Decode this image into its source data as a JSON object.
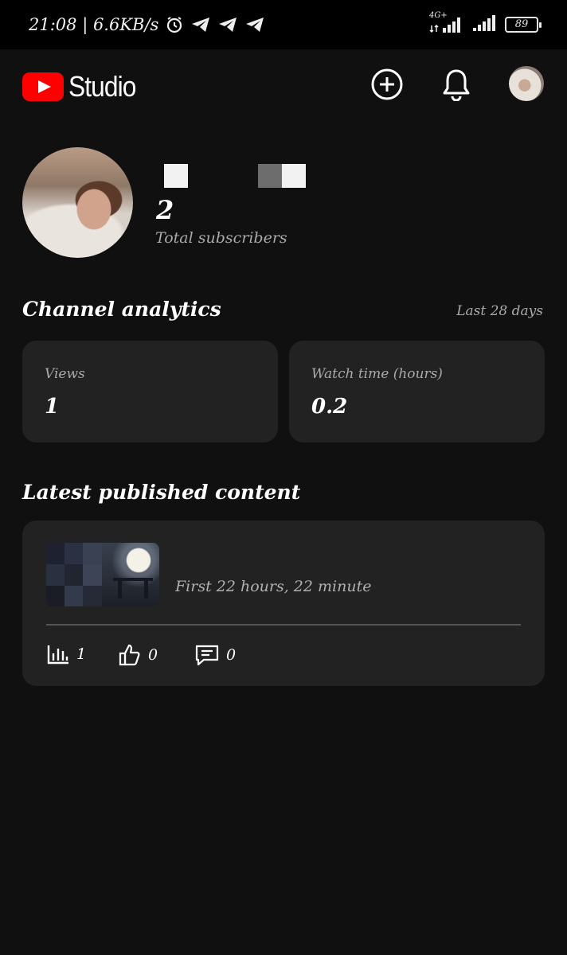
{
  "status_bar": {
    "time_speed": "21:08 | 6.6KB/s",
    "network_label": "4G+",
    "battery": "89"
  },
  "header": {
    "logo_text": "Studio",
    "icons": [
      "create-icon",
      "notifications-icon",
      "account-avatar"
    ]
  },
  "channel": {
    "subscriber_count": "2",
    "subscriber_label": "Total subscribers"
  },
  "analytics": {
    "title": "Channel analytics",
    "period": "Last 28 days",
    "cards": [
      {
        "label": "Views",
        "value": "1"
      },
      {
        "label": "Watch time (hours)",
        "value": "0.2"
      }
    ]
  },
  "latest": {
    "title": "Latest published content",
    "video_caption": "First 22 hours, 22 minute",
    "metrics": {
      "views": "1",
      "likes": "0",
      "comments": "0"
    }
  },
  "colors": {
    "background": "#101010",
    "card": "#222222",
    "brand_red": "#ff0000",
    "muted_text": "#aaaaaa"
  }
}
